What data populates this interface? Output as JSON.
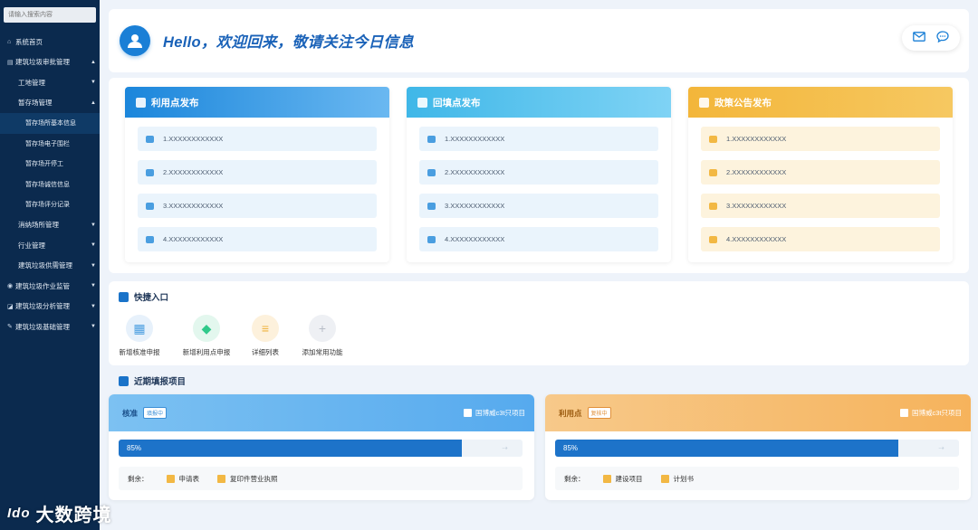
{
  "sidebar": {
    "search_placeholder": "请输入搜索内容",
    "items": [
      {
        "label": "系统首页",
        "icon": "⌂",
        "level": 1,
        "arrow": ""
      },
      {
        "label": "建筑垃圾审批管理",
        "icon": "▤",
        "level": 1,
        "arrow": "▲"
      },
      {
        "label": "工地管理",
        "icon": "",
        "level": 2,
        "arrow": "▼"
      },
      {
        "label": "暂存场管理",
        "icon": "",
        "level": 2,
        "arrow": "▲"
      },
      {
        "label": "暂存场所基本信息",
        "icon": "",
        "level": 3,
        "arrow": "",
        "active": true
      },
      {
        "label": "暂存场电子围栏",
        "icon": "",
        "level": 3,
        "arrow": ""
      },
      {
        "label": "暂存场开停工",
        "icon": "",
        "level": 3,
        "arrow": ""
      },
      {
        "label": "暂存场诚信信息",
        "icon": "",
        "level": 3,
        "arrow": ""
      },
      {
        "label": "暂存场评分记录",
        "icon": "",
        "level": 3,
        "arrow": ""
      },
      {
        "label": "消纳场所管理",
        "icon": "",
        "level": 2,
        "arrow": "▼"
      },
      {
        "label": "行业管理",
        "icon": "",
        "level": 2,
        "arrow": "▼"
      },
      {
        "label": "建筑垃圾供需管理",
        "icon": "",
        "level": 2,
        "arrow": "▼"
      },
      {
        "label": "建筑垃圾作业监管",
        "icon": "◉",
        "level": 1,
        "arrow": "▼"
      },
      {
        "label": "建筑垃圾分析管理",
        "icon": "◪",
        "level": 1,
        "arrow": "▼"
      },
      {
        "label": "建筑垃圾基础管理",
        "icon": "✎",
        "level": 1,
        "arrow": "▼"
      }
    ]
  },
  "header": {
    "greeting": "Hello，欢迎回来，敬请关注今日信息",
    "mail_icon": "mail-icon",
    "chat_icon": "chat-icon"
  },
  "panels": [
    {
      "title": "利用点发布",
      "items": [
        "1.XXXXXXXXXXXX",
        "2.XXXXXXXXXXXX",
        "3.XXXXXXXXXXXX",
        "4.XXXXXXXXXXXX"
      ]
    },
    {
      "title": "回填点发布",
      "items": [
        "1.XXXXXXXXXXXX",
        "2.XXXXXXXXXXXX",
        "3.XXXXXXXXXXXX",
        "4.XXXXXXXXXXXX"
      ]
    },
    {
      "title": "政策公告发布",
      "items": [
        "1.XXXXXXXXXXXX",
        "2.XXXXXXXXXXXX",
        "3.XXXXXXXXXXXX",
        "4.XXXXXXXXXXXX"
      ]
    }
  ],
  "quick": {
    "title": "快捷入口",
    "items": [
      {
        "label": "新增核准申报",
        "icon": "grid-icon",
        "bg": "#e7f1fb",
        "color": "#4a9ee0"
      },
      {
        "label": "新增利用点申报",
        "icon": "cube-icon",
        "bg": "#e3f7ee",
        "color": "#2fc98a"
      },
      {
        "label": "详细列表",
        "icon": "layers-icon",
        "bg": "#fdf1dc",
        "color": "#f0b23e"
      },
      {
        "label": "添加常用功能",
        "icon": "plus-icon",
        "bg": "#eef0f4",
        "color": "#b7bdc7"
      }
    ]
  },
  "recent": {
    "title": "近期填报项目",
    "cards": [
      {
        "type": "核准",
        "badge": "填报中",
        "project": "国博威c3t只项目",
        "progress": 85,
        "progress_label": "85%",
        "remaining_label": "剩余：",
        "files": [
          "申请表",
          "复印件营业执照"
        ]
      },
      {
        "type": "利用点",
        "badge": "复核中",
        "project": "国博威c3t只项目",
        "progress": 85,
        "progress_label": "85%",
        "remaining_label": "剩余：",
        "files": [
          "建设项目",
          "计划书"
        ]
      }
    ]
  },
  "watermark": {
    "logo": "Ido",
    "text": "大数跨境"
  }
}
